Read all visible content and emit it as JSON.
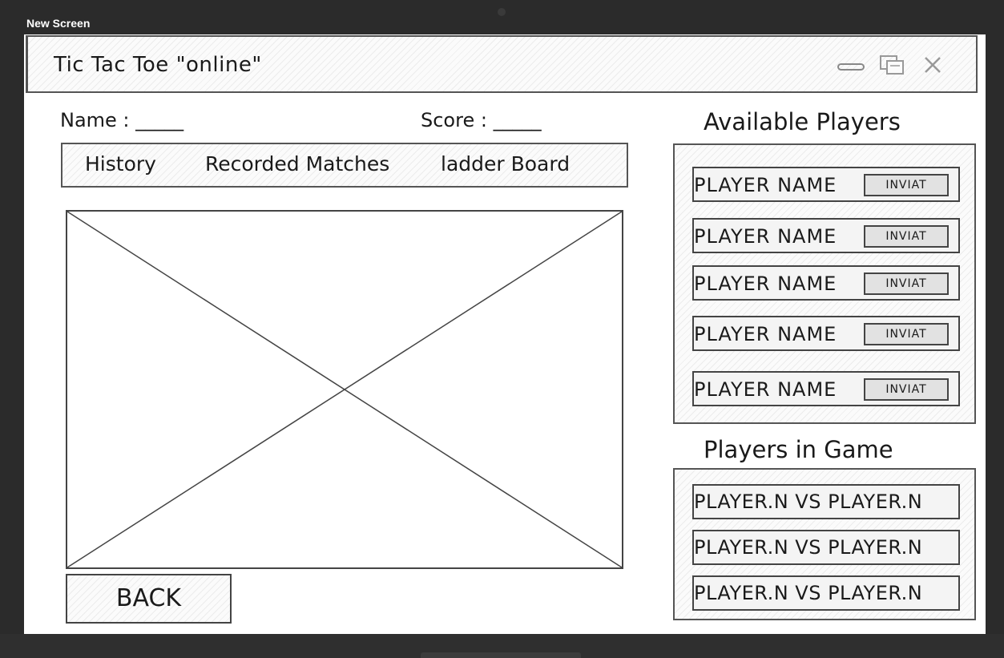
{
  "window": {
    "title": "New Screen"
  },
  "app": {
    "title": "Tic Tac Toe \"online\""
  },
  "window_controls": [
    "minimize-icon",
    "maximize-icon",
    "close-icon"
  ],
  "header": {
    "name_label": "Name : _____",
    "score_label": "Score : _____"
  },
  "nav": {
    "items": [
      "History",
      "Recorded Matches",
      "ladder Board"
    ]
  },
  "board": {
    "placeholder": "image-placeholder"
  },
  "back_button": "BACK",
  "available_players": {
    "title": "Available Players",
    "players": [
      {
        "name": "PLAYER NAME",
        "action": "INVIAT"
      },
      {
        "name": "PLAYER NAME",
        "action": "INVIAT"
      },
      {
        "name": "PLAYER NAME",
        "action": "INVIAT"
      },
      {
        "name": "PLAYER NAME",
        "action": "INVIAT"
      },
      {
        "name": "PLAYER NAME",
        "action": "INVIAT"
      }
    ]
  },
  "players_in_game": {
    "title": "Players in Game",
    "matches": [
      "PLAYER.N VS PLAYER.N",
      "PLAYER.N VS PLAYER.N",
      "PLAYER.N VS PLAYER.N"
    ]
  }
}
